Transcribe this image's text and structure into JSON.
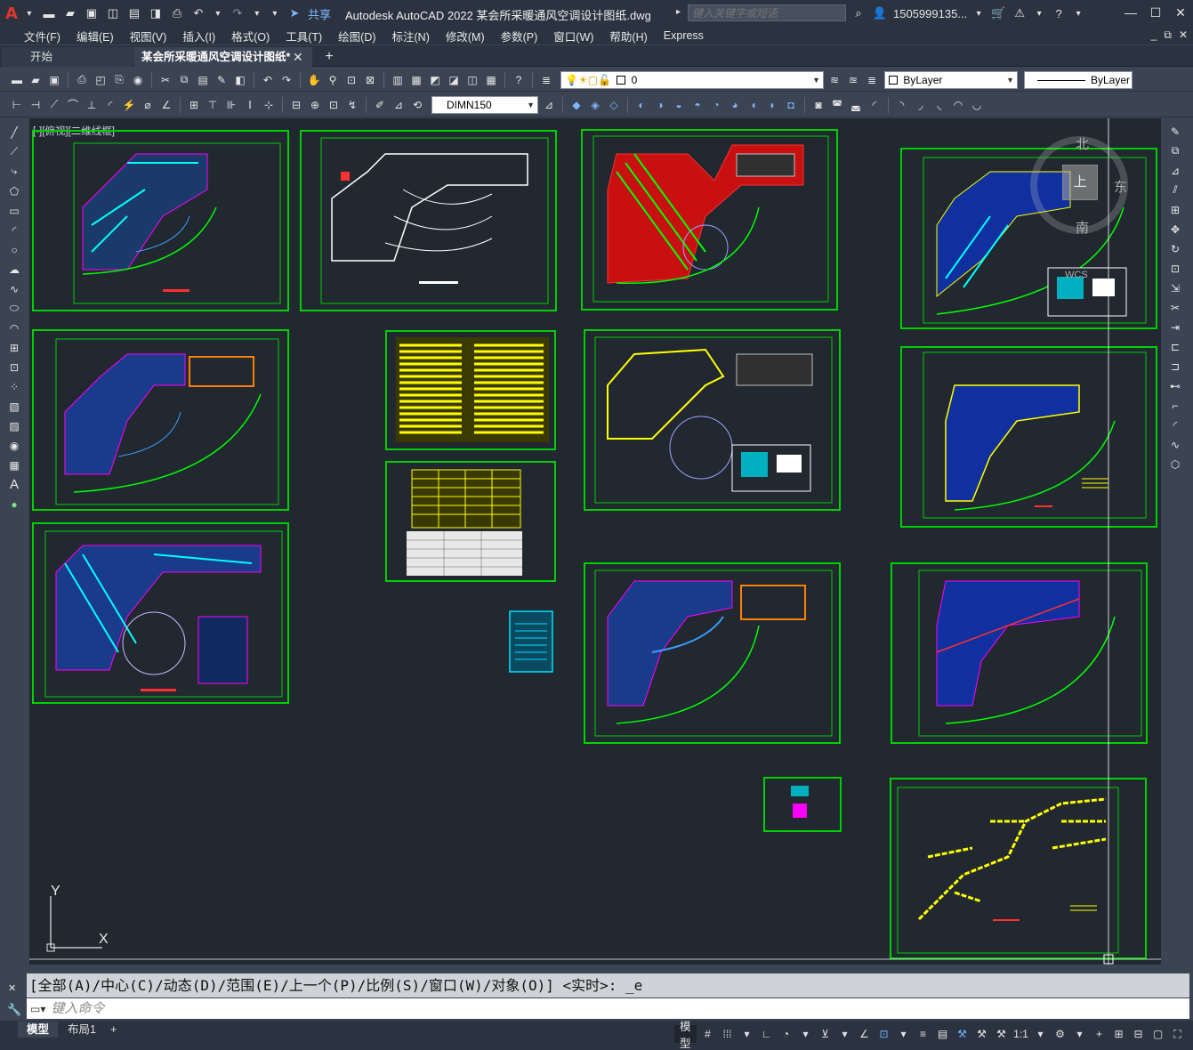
{
  "titlebar": {
    "app_logo": "A",
    "title": "Autodesk AutoCAD 2022    某会所采暖通风空调设计图纸.dwg",
    "share_label": "共享",
    "search_placeholder": "键入关键字或短语",
    "username": "1505999135...",
    "window_controls": [
      "—",
      "☐",
      "✕"
    ]
  },
  "menubar": {
    "items": [
      "文件(F)",
      "编辑(E)",
      "视图(V)",
      "插入(I)",
      "格式(O)",
      "工具(T)",
      "绘图(D)",
      "标注(N)",
      "修改(M)",
      "参数(P)",
      "窗口(W)",
      "帮助(H)",
      "Express"
    ]
  },
  "tabs": {
    "start": "开始",
    "file": "某会所采暖通风空调设计图纸*",
    "close": "✕",
    "add": "+"
  },
  "toolbar": {
    "layer_value": "0",
    "color_value": "ByLayer",
    "linetype_value": "ByLayer",
    "dimstyle_value": "DIMN150"
  },
  "viewport": {
    "label": "[-][俯视][二维线框]",
    "viewcube": {
      "north": "北",
      "east": "东",
      "south": "南",
      "top": "上",
      "wcs": "WCS"
    },
    "ucs": {
      "x": "X",
      "y": "Y"
    }
  },
  "command": {
    "history": "[全部(A)/中心(C)/动态(D)/范围(E)/上一个(P)/比例(S)/窗口(W)/对象(O)] <实时>: _e",
    "placeholder": "键入命令"
  },
  "status": {
    "tab_model": "模型",
    "tab_layout1": "布局1",
    "tab_add": "+",
    "model_button": "模型",
    "scale": "1:1"
  },
  "colors": {
    "canvas_bg": "#212830",
    "frame_green": "#00d000",
    "ui_dark": "#2b3340",
    "ui_mid": "#3b4453"
  }
}
